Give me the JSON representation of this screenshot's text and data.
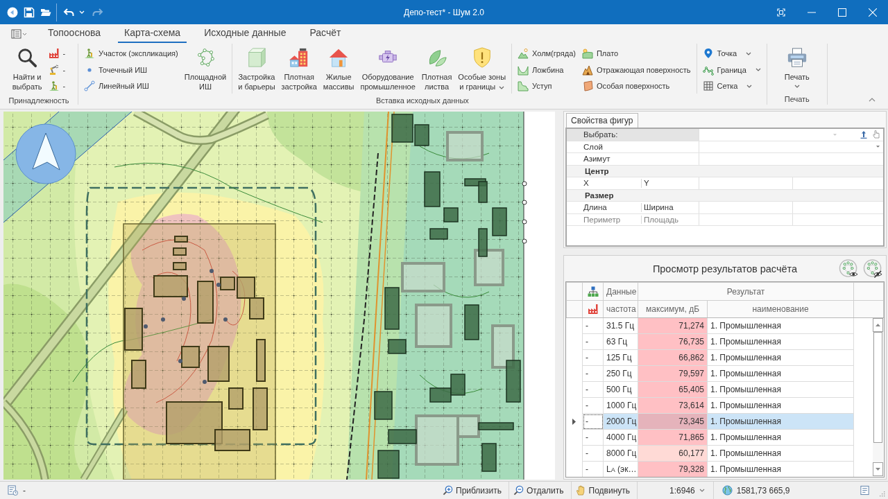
{
  "window": {
    "title": "Депо-тест* - Шум 2.0"
  },
  "quick_access": [
    {
      "disabled": false
    },
    {
      "disabled": false
    },
    {
      "disabled": false
    },
    {
      "disabled": false
    },
    {
      "disabled": false
    },
    {
      "disabled": true
    }
  ],
  "ribbon": {
    "tabs": [
      {
        "label": "Топооснова",
        "selected": false
      },
      {
        "label": "Карта-схема",
        "selected": true
      },
      {
        "label": "Исходные данные",
        "selected": false
      },
      {
        "label": "Расчёт",
        "selected": false
      }
    ],
    "groups": [
      {
        "label": "Принадлежность",
        "blocks": [
          [
            {
              "kind": "large",
              "buttons": [
                {
                  "label": "Найти и\nвыбрать",
                  "dropdown": false
                }
              ]
            },
            {
              "kind": "small",
              "buttons": [
                {
                  "label": "-",
                  "dropdown": false
                },
                {
                  "label": "-",
                  "dropdown": false
                },
                {
                  "label": "-",
                  "dropdown": false
                }
              ]
            }
          ]
        ]
      },
      {
        "label": "Вставка исходных данных",
        "blocks": [
          [
            {
              "kind": "small",
              "buttons": [
                {
                  "label": "Участок (экспликация)",
                  "dropdown": false
                },
                {
                  "label": "Точечный ИШ",
                  "dropdown": false
                },
                {
                  "label": "Линейный ИШ",
                  "dropdown": false
                }
              ]
            },
            {
              "kind": "large",
              "buttons": [
                {
                  "label": "Площадной\nИШ",
                  "dropdown": false
                }
              ]
            }
          ],
          [
            {
              "kind": "large",
              "buttons": [
                {
                  "label": "Застройка\nи барьеры",
                  "dropdown": false
                },
                {
                  "label": "Плотная\nзастройка",
                  "dropdown": false
                },
                {
                  "label": "Жилые\nмассивы",
                  "dropdown": false
                },
                {
                  "label": "Оборудование\nпромышленное",
                  "dropdown": false
                },
                {
                  "label": "Плотная\nлиства",
                  "dropdown": false
                },
                {
                  "label": "Особые зоны\nи границы",
                  "dropdown": true
                }
              ]
            }
          ],
          [
            {
              "kind": "small",
              "buttons": [
                {
                  "label": "Холм(гряда)",
                  "dropdown": false
                },
                {
                  "label": "Ложбина",
                  "dropdown": false
                },
                {
                  "label": "Уступ",
                  "dropdown": false
                }
              ]
            },
            {
              "kind": "small",
              "buttons": [
                {
                  "label": "Плато",
                  "dropdown": false
                },
                {
                  "label": "Отражающая поверхность",
                  "dropdown": false
                },
                {
                  "label": "Особая поверхность",
                  "dropdown": false
                }
              ]
            }
          ],
          [
            {
              "kind": "small",
              "buttons": [
                {
                  "label": "Точка",
                  "dropdown": true
                },
                {
                  "label": "Граница",
                  "dropdown": true
                },
                {
                  "label": "Сетка",
                  "dropdown": true
                }
              ]
            }
          ]
        ]
      },
      {
        "label": "Печать",
        "blocks": [
          [
            {
              "kind": "large",
              "buttons": [
                {
                  "label": "Печать",
                  "dropdown": true
                }
              ]
            }
          ]
        ]
      }
    ]
  },
  "properties": {
    "tab": "Свойства фигур",
    "rows": [
      {
        "kind": "selector",
        "label": "Выбрать:",
        "disabled": false
      },
      {
        "kind": "dropdown",
        "label": "Слой",
        "disabled": false
      },
      {
        "kind": "field",
        "label": "Азимут",
        "disabled": false
      },
      {
        "kind": "category",
        "label": "Центр",
        "disabled": false
      },
      {
        "kind": "pair",
        "labels": [
          "X",
          "Y"
        ],
        "disabled": false
      },
      {
        "kind": "category",
        "label": "Размер",
        "disabled": false
      },
      {
        "kind": "pair",
        "labels": [
          "Длина",
          "Ширина"
        ],
        "disabled": false
      },
      {
        "kind": "pair",
        "labels": [
          "Периметр",
          "Площадь"
        ],
        "disabled": true
      }
    ]
  },
  "results": {
    "title": "Просмотр результатов расчёта",
    "column_groups": [
      "Данные",
      "Результат"
    ],
    "columns": [
      "частота",
      "максимум, дБ",
      "наименование"
    ],
    "rows": [
      {
        "column_1": "-",
        "frequency": "31.5 Гц",
        "maximum": "71,274",
        "name": "1. Промышленная",
        "color": "#ffc0c4",
        "selected": false
      },
      {
        "column_1": "-",
        "frequency": "63 Гц",
        "maximum": "76,735",
        "name": "1. Промышленная",
        "color": "#ffc0c4",
        "selected": false
      },
      {
        "column_1": "-",
        "frequency": "125 Гц",
        "maximum": "66,862",
        "name": "1. Промышленная",
        "color": "#ffc0c4",
        "selected": false
      },
      {
        "column_1": "-",
        "frequency": "250 Гц",
        "maximum": "79,597",
        "name": "1. Промышленная",
        "color": "#ffc0c4",
        "selected": false
      },
      {
        "column_1": "-",
        "frequency": "500 Гц",
        "maximum": "65,405",
        "name": "1. Промышленная",
        "color": "#ffc0c4",
        "selected": false
      },
      {
        "column_1": "-",
        "frequency": "1000 Гц",
        "maximum": "73,614",
        "name": "1. Промышленная",
        "color": "#ffc0c4",
        "selected": false
      },
      {
        "column_1": "-",
        "frequency": "2000 Гц",
        "maximum": "73,345",
        "name": "1. Промышленная",
        "color": "#e5b3bb",
        "selected": true
      },
      {
        "column_1": "-",
        "frequency": "4000 Гц",
        "maximum": "71,865",
        "name": "1. Промышленная",
        "color": "#ffc0c4",
        "selected": false
      },
      {
        "column_1": "-",
        "frequency": "8000 Гц",
        "maximum": "60,177",
        "name": "1. Промышленная",
        "color": "#ffdad6",
        "selected": false
      },
      {
        "column_1": "-",
        "frequency": "L$_{A}$ (эк…",
        "maximum": "79,328",
        "name": "1. Промышленная",
        "color": "#ffc0c4",
        "selected": false
      }
    ]
  },
  "status_bar": {
    "text": "-",
    "buttons": [
      {
        "label": "Приблизить"
      },
      {
        "label": "Отдалить"
      },
      {
        "label": "Подвинуть"
      }
    ],
    "scale": "1:6946",
    "coordinates": "1581,73 665,9"
  }
}
